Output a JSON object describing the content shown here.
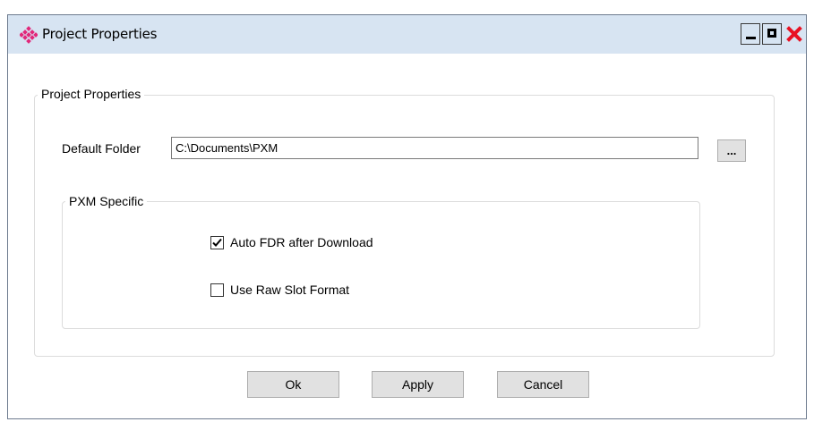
{
  "window": {
    "title": "Project Properties",
    "icon": "diamond-dots-icon",
    "brand_color": "#e2287a",
    "titlebar_color": "#d7e4f2",
    "controls": {
      "minimize_icon": "minimize-icon",
      "maximize_icon": "maximize-icon",
      "close_icon": "close-icon",
      "close_color": "#e81123"
    }
  },
  "project_group": {
    "legend": "Project Properties",
    "default_folder": {
      "label": "Default Folder",
      "value": "C:\\Documents\\PXM",
      "browse_label": "..."
    }
  },
  "pxm_group": {
    "legend": "PXM Specific",
    "options": [
      {
        "label": "Auto FDR after Download",
        "checked": true
      },
      {
        "label": "Use Raw Slot Format",
        "checked": false
      }
    ]
  },
  "buttons": {
    "ok": "Ok",
    "apply": "Apply",
    "cancel": "Cancel"
  }
}
